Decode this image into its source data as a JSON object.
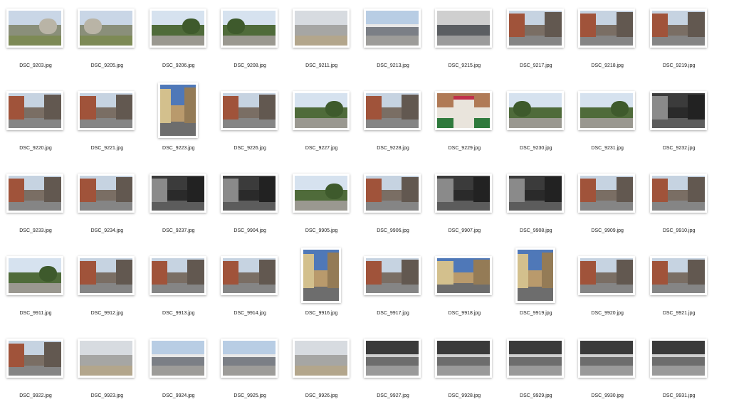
{
  "files": [
    {
      "name": "DSC_9203.jpg",
      "orientation": "landscape",
      "scene": "field"
    },
    {
      "name": "DSC_9205.jpg",
      "orientation": "landscape",
      "scene": "field"
    },
    {
      "name": "DSC_9206.jpg",
      "orientation": "landscape",
      "scene": "park"
    },
    {
      "name": "DSC_9208.jpg",
      "orientation": "landscape",
      "scene": "park"
    },
    {
      "name": "DSC_9211.jpg",
      "orientation": "landscape",
      "scene": "plaza"
    },
    {
      "name": "DSC_9213.jpg",
      "orientation": "landscape",
      "scene": "station"
    },
    {
      "name": "DSC_9215.jpg",
      "orientation": "landscape",
      "scene": "facade"
    },
    {
      "name": "DSC_9217.jpg",
      "orientation": "landscape",
      "scene": "street"
    },
    {
      "name": "DSC_9218.jpg",
      "orientation": "landscape",
      "scene": "street"
    },
    {
      "name": "DSC_9219.jpg",
      "orientation": "landscape",
      "scene": "street"
    },
    {
      "name": "DSC_9220.jpg",
      "orientation": "landscape",
      "scene": "street"
    },
    {
      "name": "DSC_9221.jpg",
      "orientation": "landscape",
      "scene": "street"
    },
    {
      "name": "DSC_9223.jpg",
      "orientation": "portrait",
      "scene": "tower"
    },
    {
      "name": "DSC_9226.jpg",
      "orientation": "landscape",
      "scene": "street"
    },
    {
      "name": "DSC_9227.jpg",
      "orientation": "landscape",
      "scene": "park"
    },
    {
      "name": "DSC_9228.jpg",
      "orientation": "landscape",
      "scene": "street"
    },
    {
      "name": "DSC_9229.jpg",
      "orientation": "landscape",
      "scene": "poster"
    },
    {
      "name": "DSC_9230.jpg",
      "orientation": "landscape",
      "scene": "park"
    },
    {
      "name": "DSC_9231.jpg",
      "orientation": "landscape",
      "scene": "park"
    },
    {
      "name": "DSC_9232.jpg",
      "orientation": "landscape",
      "scene": "dark"
    },
    {
      "name": "DSC_9233.jpg",
      "orientation": "landscape",
      "scene": "street"
    },
    {
      "name": "DSC_9234.jpg",
      "orientation": "landscape",
      "scene": "street"
    },
    {
      "name": "DSC_9237.jpg",
      "orientation": "landscape",
      "scene": "dark"
    },
    {
      "name": "DSC_9904.jpg",
      "orientation": "landscape",
      "scene": "dark"
    },
    {
      "name": "DSC_9905.jpg",
      "orientation": "landscape",
      "scene": "park"
    },
    {
      "name": "DSC_9906.jpg",
      "orientation": "landscape",
      "scene": "street"
    },
    {
      "name": "DSC_9907.jpg",
      "orientation": "landscape",
      "scene": "dark"
    },
    {
      "name": "DSC_9908.jpg",
      "orientation": "landscape",
      "scene": "dark"
    },
    {
      "name": "DSC_9909.jpg",
      "orientation": "landscape",
      "scene": "street"
    },
    {
      "name": "DSC_9910.jpg",
      "orientation": "landscape",
      "scene": "street"
    },
    {
      "name": "DSC_9911.jpg",
      "orientation": "landscape",
      "scene": "park"
    },
    {
      "name": "DSC_9912.jpg",
      "orientation": "landscape",
      "scene": "street"
    },
    {
      "name": "DSC_9913.jpg",
      "orientation": "landscape",
      "scene": "street"
    },
    {
      "name": "DSC_9914.jpg",
      "orientation": "landscape",
      "scene": "street"
    },
    {
      "name": "DSC_9916.jpg",
      "orientation": "portrait",
      "scene": "tower"
    },
    {
      "name": "DSC_9917.jpg",
      "orientation": "landscape",
      "scene": "street"
    },
    {
      "name": "DSC_9918.jpg",
      "orientation": "landscape",
      "scene": "tower"
    },
    {
      "name": "DSC_9919.jpg",
      "orientation": "portrait",
      "scene": "tower"
    },
    {
      "name": "DSC_9920.jpg",
      "orientation": "landscape",
      "scene": "street"
    },
    {
      "name": "DSC_9921.jpg",
      "orientation": "landscape",
      "scene": "street"
    },
    {
      "name": "DSC_9922.jpg",
      "orientation": "landscape",
      "scene": "street"
    },
    {
      "name": "DSC_9923.jpg",
      "orientation": "landscape",
      "scene": "plaza"
    },
    {
      "name": "DSC_9924.jpg",
      "orientation": "landscape",
      "scene": "station"
    },
    {
      "name": "DSC_9925.jpg",
      "orientation": "landscape",
      "scene": "station"
    },
    {
      "name": "DSC_9926.jpg",
      "orientation": "landscape",
      "scene": "plaza"
    },
    {
      "name": "DSC_9927.jpg",
      "orientation": "landscape",
      "scene": "interior"
    },
    {
      "name": "DSC_9928.jpg",
      "orientation": "landscape",
      "scene": "interior"
    },
    {
      "name": "DSC_9929.jpg",
      "orientation": "landscape",
      "scene": "interior"
    },
    {
      "name": "DSC_9930.jpg",
      "orientation": "landscape",
      "scene": "interior"
    },
    {
      "name": "DSC_9931.jpg",
      "orientation": "landscape",
      "scene": "interior"
    }
  ],
  "scene_palettes": {
    "field": {
      "sky": "#c9d6e6",
      "mid": "#8a8f7a",
      "ground": "#7d8a55",
      "accent": "#b9b4a6"
    },
    "park": {
      "sky": "#d6e2ef",
      "mid": "#4f6b3a",
      "ground": "#9a9890",
      "accent": "#3e5a2c"
    },
    "plaza": {
      "sky": "#d7dbe0",
      "mid": "#a6a6a4",
      "ground": "#b3a68c",
      "accent": "#6f6f6f"
    },
    "station": {
      "sky": "#b8cde4",
      "mid": "#7b7f86",
      "ground": "#9d9c99",
      "accent": "#e8e8e8"
    },
    "facade": {
      "sky": "#cfcfcf",
      "mid": "#5b5e62",
      "ground": "#9b9b9b",
      "accent": "#e2e2e2"
    },
    "street": {
      "sky": "#c6d3e1",
      "mid": "#7a6e64",
      "ground": "#858585",
      "accent": "#a0533a"
    },
    "tower": {
      "sky": "#4f78b8",
      "mid": "#b99a6c",
      "ground": "#6d6d6d",
      "accent": "#d3c08d"
    },
    "poster": {
      "sky": "#b07a56",
      "mid": "#e9e4dc",
      "ground": "#2f7a3d",
      "accent": "#c0304a"
    },
    "dark": {
      "sky": "#3b3b3b",
      "mid": "#2a2a2a",
      "ground": "#5c5c5c",
      "accent": "#8a8a8a"
    },
    "interior": {
      "sky": "#3a3a3a",
      "mid": "#6d6d6d",
      "ground": "#9a9a9a",
      "accent": "#cfcfcf"
    }
  }
}
